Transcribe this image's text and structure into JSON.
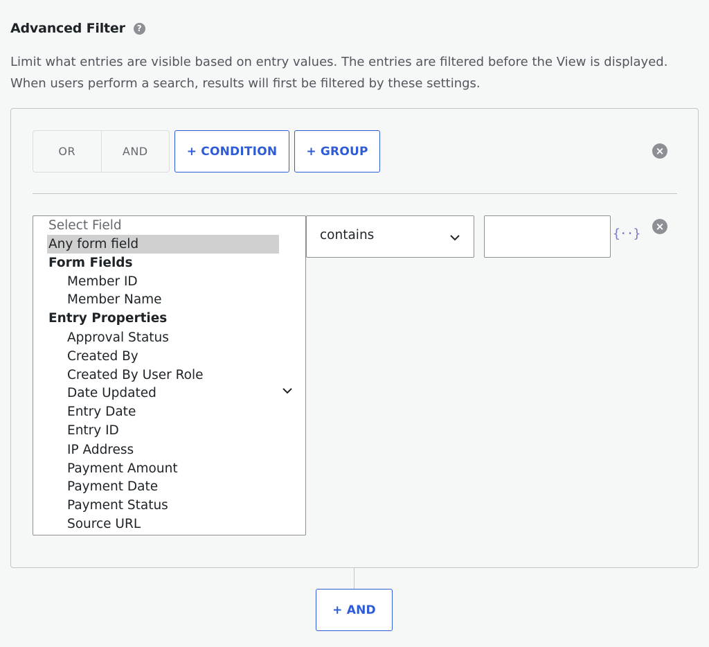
{
  "header": {
    "title": "Advanced Filter",
    "help_icon": "?",
    "description": "Limit what entries are visible based on entry values. The entries are filtered before the View is displayed. When users perform a search, results will first be filtered by these settings."
  },
  "group": {
    "toggle": [
      "OR",
      "AND"
    ],
    "add_condition_label": "+ CONDITION",
    "add_group_label": "+ GROUP",
    "remove_icon": "×"
  },
  "condition": {
    "field_select": {
      "placeholder": "Select Field",
      "selected": "Any form field",
      "groups": [
        {
          "label": "Form Fields",
          "options": [
            "Member ID",
            "Member Name"
          ]
        },
        {
          "label": "Entry Properties",
          "options": [
            "Approval Status",
            "Created By",
            "Created By User Role",
            "Date Updated",
            "Entry Date",
            "Entry ID",
            "IP Address",
            "Payment Amount",
            "Payment Date",
            "Payment Status",
            "Source URL"
          ]
        }
      ]
    },
    "operator": "contains",
    "value": "",
    "merge_tag_icon": "{··}",
    "remove_icon": "×"
  },
  "footer": {
    "add_and_label": "+ AND"
  },
  "colors": {
    "accent": "#2e5bd6",
    "icon_gray": "#8c8f94",
    "merge_tag": "#7678c9",
    "background": "#f6f7f7"
  }
}
